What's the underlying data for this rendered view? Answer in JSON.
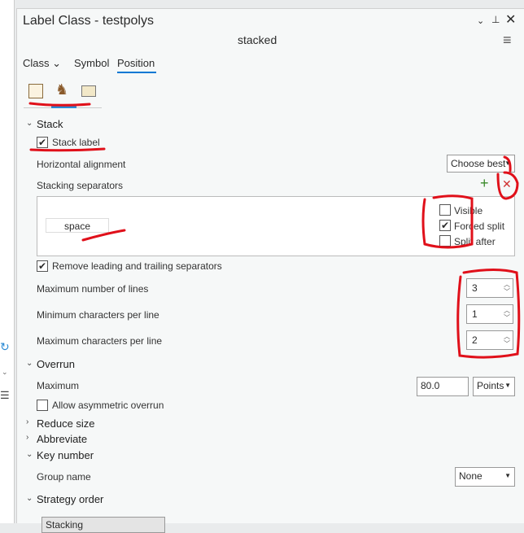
{
  "panel": {
    "title": "Label Class - testpolys",
    "subtitle": "stacked"
  },
  "tabs": [
    {
      "label": "Class"
    },
    {
      "label": "Symbol"
    },
    {
      "label": "Position"
    }
  ],
  "stack": {
    "header": "Stack",
    "stack_label": "Stack label",
    "horiz_align_label": "Horizontal alignment",
    "horiz_align_value": "Choose best",
    "separators_label": "Stacking separators",
    "separator_item": "space",
    "visible": "Visible",
    "forced_split": "Forced split",
    "split_after": "Split after",
    "remove_sep": "Remove leading and trailing separators",
    "max_lines_label": "Maximum number of lines",
    "max_lines": "3",
    "min_chars_label": "Minimum characters per line",
    "min_chars": "1",
    "max_chars_label": "Maximum characters per line",
    "max_chars": "2"
  },
  "overrun": {
    "header": "Overrun",
    "max_label": "Maximum",
    "max_value": "80.0",
    "unit": "Points",
    "asym": "Allow asymmetric overrun"
  },
  "sections": {
    "reduce": "Reduce size",
    "abbreviate": "Abbreviate",
    "key": "Key number",
    "group_label": "Group name",
    "group_value": "None",
    "strategy": "Strategy order",
    "strategy_item": "Stacking"
  },
  "colors": {
    "accent": "#0078d4",
    "annotation": "#e0101a"
  }
}
